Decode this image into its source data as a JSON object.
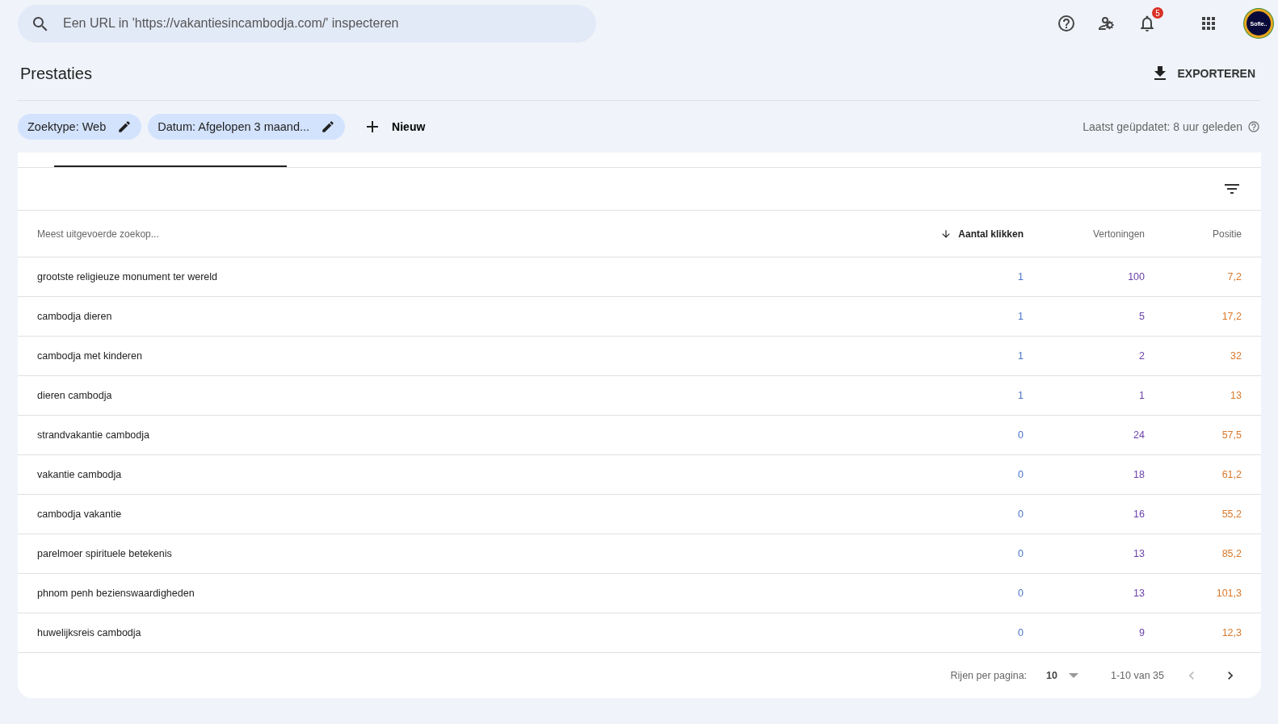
{
  "search": {
    "placeholder": "Een URL in 'https://vakantiesincambodja.com/' inspecteren"
  },
  "header": {
    "notification_count": "5",
    "avatar_text": "Sofie.."
  },
  "page": {
    "title": "Prestaties",
    "export_label": "EXPORTEREN"
  },
  "filters": [
    {
      "label": "Zoektype: Web"
    },
    {
      "label": "Datum: Afgelopen 3 maand..."
    }
  ],
  "new_filter": "Nieuw",
  "last_updated": "Laatst geüpdatet: 8 uur geleden",
  "table": {
    "columns": [
      {
        "label": "Meest uitgevoerde zoekop...",
        "sorted": false
      },
      {
        "label": "Aantal klikken",
        "sorted": true,
        "color": "#4a74c9"
      },
      {
        "label": "Vertoningen",
        "sorted": false,
        "color": "#6a3fa8"
      },
      {
        "label": "Positie",
        "sorted": false,
        "color": "#d9782a"
      }
    ],
    "rows": [
      [
        "grootste religieuze monument ter wereld",
        "1",
        "100",
        "7,2"
      ],
      [
        "cambodja dieren",
        "1",
        "5",
        "17,2"
      ],
      [
        "cambodja met kinderen",
        "1",
        "2",
        "32"
      ],
      [
        "dieren cambodja",
        "1",
        "1",
        "13"
      ],
      [
        "strandvakantie cambodja",
        "0",
        "24",
        "57,5"
      ],
      [
        "vakantie cambodja",
        "0",
        "18",
        "61,2"
      ],
      [
        "cambodja vakantie",
        "0",
        "16",
        "55,2"
      ],
      [
        "parelmoer spirituele betekenis",
        "0",
        "13",
        "85,2"
      ],
      [
        "phnom penh bezienswaardigheden",
        "0",
        "13",
        "101,3"
      ],
      [
        "huwelijksreis cambodja",
        "0",
        "9",
        "12,3"
      ]
    ]
  },
  "pagination": {
    "rows_per_page_label": "Rijen per pagina:",
    "rows_per_page": "10",
    "range": "1-10 van 35",
    "prev_disabled": true,
    "next_disabled": false
  }
}
